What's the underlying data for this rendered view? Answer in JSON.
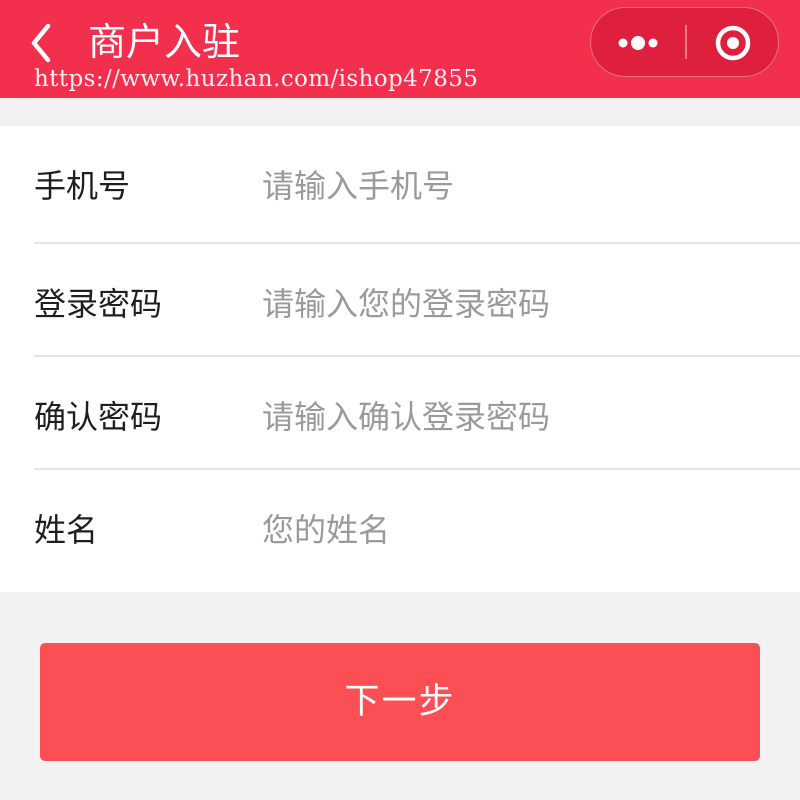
{
  "header": {
    "title": "商户入驻",
    "watermark": "https://www.huzhan.com/ishop47855",
    "back_icon": "chevron-left-icon",
    "menu_icon": "more-dots-icon",
    "close_icon": "target-circle-icon",
    "background_color": "#f2304e"
  },
  "form": {
    "fields": [
      {
        "label": "手机号",
        "placeholder": "请输入手机号",
        "value": ""
      },
      {
        "label": "登录密码",
        "placeholder": "请输入您的登录密码",
        "value": ""
      },
      {
        "label": "确认密码",
        "placeholder": "请输入确认登录密码",
        "value": ""
      },
      {
        "label": "姓名",
        "placeholder": "您的姓名",
        "value": ""
      }
    ]
  },
  "actions": {
    "next_label": "下一步",
    "next_color": "#fb4e55"
  }
}
